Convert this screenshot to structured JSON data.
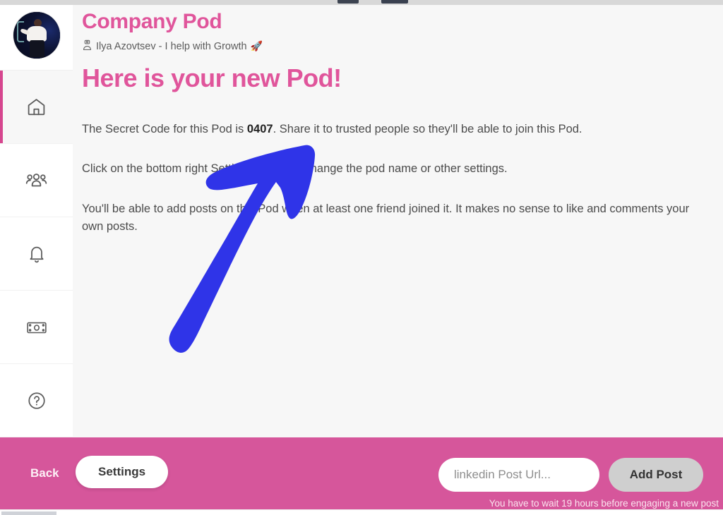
{
  "window": {
    "background_color": "#f7f7f7",
    "accent_pink": "#e0559b",
    "bar_pink": "#d6569b",
    "annotation_color": "#2f34e8"
  },
  "sidebar": {
    "avatar": {
      "name": "user-avatar",
      "alt": "Profile photo of Ilya Azovtsev"
    },
    "items": [
      {
        "icon": "home-icon",
        "label": "Home",
        "active": true
      },
      {
        "icon": "people-group-icon",
        "label": "Members",
        "active": false
      },
      {
        "icon": "bell-icon",
        "label": "Notifications",
        "active": false
      },
      {
        "icon": "banknote-icon",
        "label": "Billing",
        "active": false
      },
      {
        "icon": "help-circle-icon",
        "label": "Help",
        "active": false
      }
    ]
  },
  "header": {
    "pod_title": "Company Pod",
    "owner_icon": "user-badge-icon",
    "owner_text": "Ilya Azovtsev - I help with Growth",
    "owner_emoji": "🚀"
  },
  "main": {
    "headline": "Here is your new Pod!",
    "paragraphs": [
      {
        "before": "The Secret Code for this Pod is ",
        "code": "0407",
        "after": ". Share it to trusted people so they'll be able to join this Pod."
      },
      {
        "text": "Click on the bottom right Settings button to change the pod name or other settings."
      },
      {
        "text": "You'll be able to add posts on this Pod when at least one friend joined it. It makes no sense to like and comments your own posts."
      }
    ]
  },
  "annotation": {
    "name": "hand-drawn-arrow",
    "direction": "up-right",
    "color": "#2f34e8"
  },
  "bottombar": {
    "back_label": "Back",
    "settings_label": "Settings",
    "post_url_placeholder": "linkedin Post Url...",
    "post_url_value": "",
    "add_post_label": "Add Post",
    "wait_note": "You have to wait 19 hours before engaging a new post"
  }
}
